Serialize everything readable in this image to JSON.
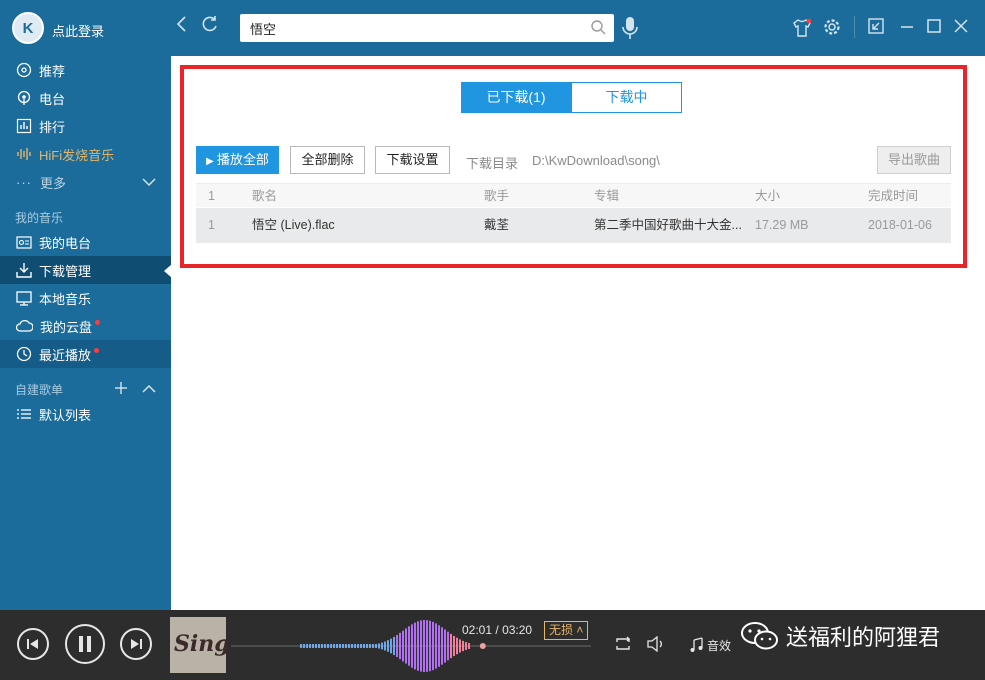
{
  "topbar": {
    "login_label": "点此登录",
    "search_value": "悟空",
    "logo_glyph": "K",
    "icons": [
      "back-icon",
      "refresh-icon",
      "search-icon",
      "mic-icon",
      "shirt-icon",
      "gear-icon",
      "mini-mode-icon",
      "minimize-icon",
      "maximize-icon",
      "close-icon"
    ]
  },
  "sidebar": {
    "nav": [
      {
        "label": "推荐"
      },
      {
        "label": "电台"
      },
      {
        "label": "排行"
      },
      {
        "label": "HiFi发烧音乐"
      },
      {
        "label": "更多"
      }
    ],
    "my_music_title": "我的音乐",
    "my_music": [
      {
        "label": "我的电台"
      },
      {
        "label": "下载管理"
      },
      {
        "label": "本地音乐"
      },
      {
        "label": "我的云盘"
      },
      {
        "label": "最近播放"
      }
    ],
    "playlists_title": "自建歌单",
    "playlists": [
      {
        "label": "默认列表"
      }
    ]
  },
  "download": {
    "tabs": [
      {
        "label": "已下载(1)",
        "selected": true
      },
      {
        "label": "下载中",
        "selected": false
      }
    ],
    "toolbar": {
      "play_all": "播放全部",
      "delete_all": "全部删除",
      "settings": "下载设置",
      "dir_label": "下载目录",
      "dir_value": "D:\\KwDownload\\song\\",
      "export": "导出歌曲"
    },
    "columns": {
      "index": "1",
      "name": "歌名",
      "artist": "歌手",
      "album": "专辑",
      "size": "大小",
      "finished": "完成时间"
    },
    "rows": [
      {
        "index": "1",
        "name": "悟空 (Live).flac",
        "artist": "戴荃",
        "album": "第二季中国好歌曲十大金...",
        "size": "17.29 MB",
        "finished": "2018-01-06"
      }
    ]
  },
  "player": {
    "elapsed": "02:01",
    "sep": "/",
    "total": "03:20",
    "quality": "无损 ˄",
    "effect_label": "音效",
    "cover_text": "Sing",
    "progress_fraction": 0.605
  },
  "watermark": {
    "text": "送福利的阿狸君"
  },
  "colors": {
    "sidebar_bg": "#1b6c9b",
    "active_bg": "#104d73",
    "accent": "#2196e0",
    "highlight": "#e8262a",
    "hifi": "#e3b66a",
    "player_bg": "#2d2d2d",
    "wave_start": "#5ab4f0",
    "wave_mid": "#b070f0",
    "wave_end": "#f08080"
  }
}
